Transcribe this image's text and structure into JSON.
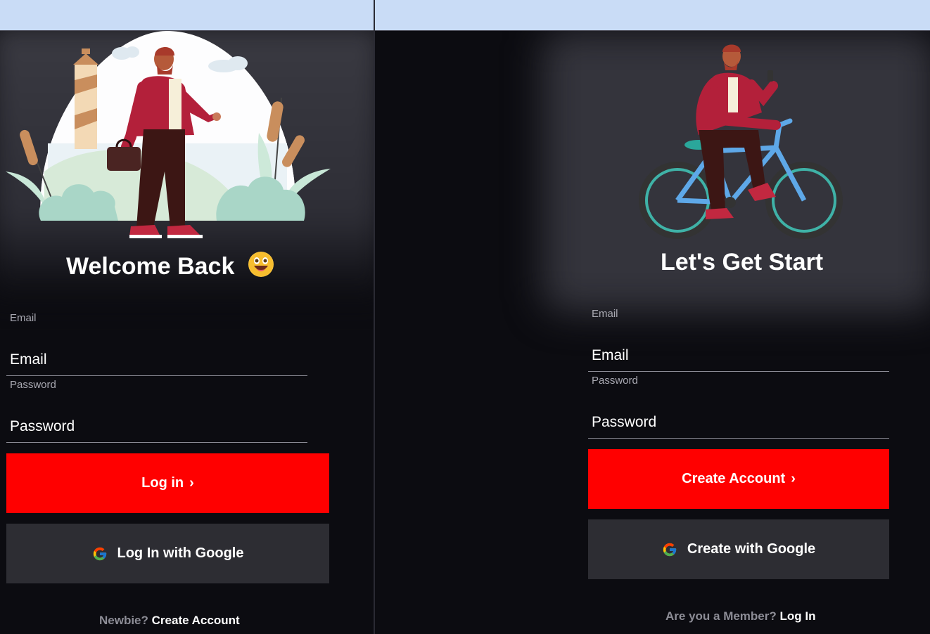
{
  "colors": {
    "accent": "#ff0000",
    "panel_bg": "#0c0c11",
    "google_btn": "#2d2d33",
    "topbar": "#c9dcf6"
  },
  "login": {
    "title": "Welcome Back",
    "emoji": "😛",
    "email_label": "Email",
    "email_placeholder": "Email",
    "password_label": "Password",
    "password_placeholder": "Password",
    "submit_label": "Log in",
    "google_label": "Log In with Google",
    "footer_prompt": "Newbie?",
    "footer_link": "Create Account"
  },
  "signup": {
    "title": "Let's Get Start",
    "email_label": "Email",
    "email_placeholder": "Email",
    "password_label": "Password",
    "password_placeholder": "Password",
    "submit_label": "Create Account",
    "google_label": "Create with Google",
    "footer_prompt": "Are you a Member?",
    "footer_link": "Log In"
  },
  "icons": {
    "chevron": "chevron-right-icon",
    "google": "google-icon"
  }
}
